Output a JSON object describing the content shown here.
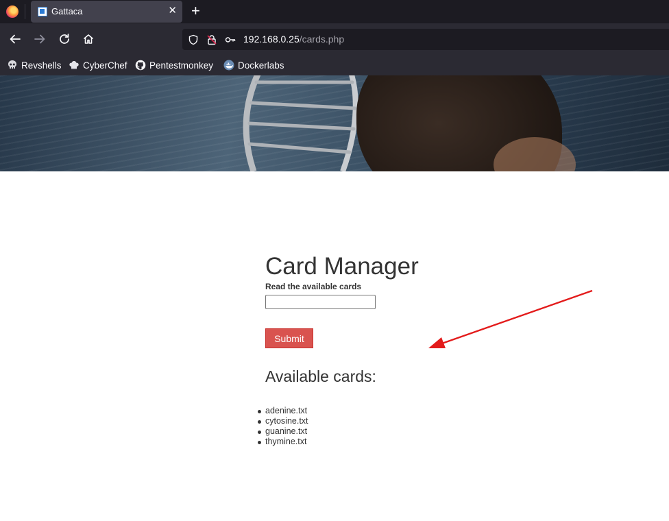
{
  "browser": {
    "tab": {
      "title": "Gattaca"
    },
    "url": {
      "host": "192.168.0.25",
      "path": "/cards.php"
    },
    "bookmarks": [
      {
        "label": "Revshells",
        "icon": "skull-icon"
      },
      {
        "label": "CyberChef",
        "icon": "chef-hat-icon"
      },
      {
        "label": "Pentestmonkey",
        "icon": "github-icon"
      },
      {
        "label": "Dockerlabs",
        "icon": "docker-icon"
      }
    ]
  },
  "page": {
    "title": "Card Manager",
    "form": {
      "label": "Read the available cards",
      "input_value": "",
      "submit_label": "Submit"
    },
    "available_heading": "Available cards:",
    "cards": [
      "adenine.txt",
      "cytosine.txt",
      "guanine.txt",
      "thymine.txt"
    ]
  },
  "colors": {
    "submit_bg": "#d9534f",
    "arrow": "#e31b1b",
    "tab_bg": "#42414d",
    "toolbar_bg": "#2b2a33"
  }
}
